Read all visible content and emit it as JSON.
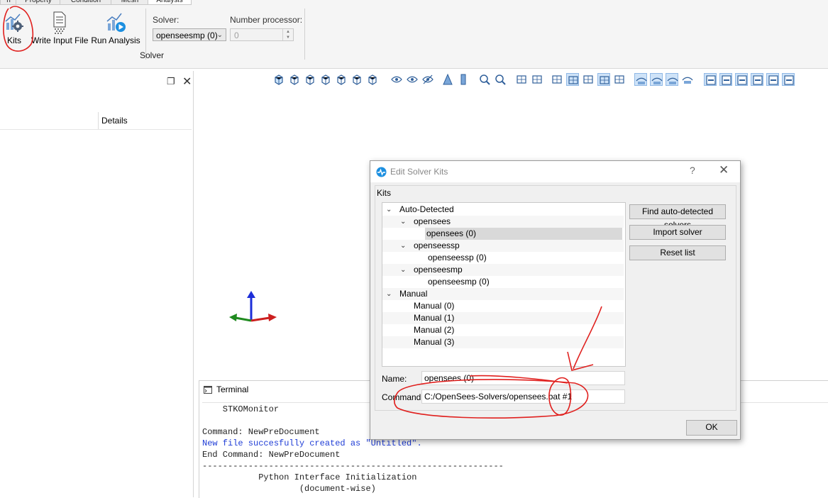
{
  "ribbon": {
    "tabs": [
      "n",
      "Property",
      "Condition",
      "Mesh",
      "Analysis"
    ],
    "buttons": {
      "kits": "Kits",
      "write_input_file": "Write Input File",
      "run_analysis": "Run Analysis"
    },
    "solver_label": "Solver:",
    "solver_value": "openseesmp (0)",
    "nproc_label": "Number processor:",
    "nproc_value": "0",
    "group_label": "Solver"
  },
  "left_panel": {
    "details_header": "Details"
  },
  "view_toolbar": {
    "icons": [
      "iso-view-icon",
      "front-view-icon",
      "back-view-icon",
      "left-view-icon",
      "right-view-icon",
      "top-view-icon",
      "bottom-view-icon",
      "eye-outline-icon",
      "eye-icon",
      "eye-crossed-icon",
      "perspective-icon",
      "orthographic-icon",
      "zoom-fit-icon",
      "zoom-icon",
      "screenshot-icon",
      "pick-icon",
      "grid-icon",
      "grid-selected-icon",
      "angle-icon",
      "select-box-icon",
      "select-tool-icon",
      "show-a-icon",
      "show-b-icon",
      "show-c-icon",
      "hide-icon",
      "layer-1-icon",
      "layer-2-icon",
      "layer-3-icon",
      "layer-4-icon",
      "layer-5-icon",
      "layer-6-icon"
    ]
  },
  "terminal": {
    "title": "Terminal",
    "lines": [
      {
        "text": "    STKOMonitor",
        "color": "normal"
      },
      {
        "text": "",
        "color": "normal"
      },
      {
        "text": "Command: NewPreDocument",
        "color": "normal"
      },
      {
        "text": "New file succesfully created as \"Untitled\".",
        "color": "blue"
      },
      {
        "text": "End Command: NewPreDocument",
        "color": "normal"
      },
      {
        "text": "-----------------------------------------------------------",
        "color": "normal"
      },
      {
        "text": "           Python Interface Initialization",
        "color": "normal"
      },
      {
        "text": "                   (document-wise)",
        "color": "normal"
      }
    ]
  },
  "dialog": {
    "title": "Edit Solver Kits",
    "help": "?",
    "close": "✕",
    "group_label": "Kits",
    "tree": [
      {
        "label": "Auto-Detected",
        "level": 0,
        "expanded": true,
        "selected": false
      },
      {
        "label": "opensees",
        "level": 1,
        "expanded": true,
        "selected": false
      },
      {
        "label": "opensees (0)",
        "level": 2,
        "expanded": false,
        "selected": true
      },
      {
        "label": "openseessp",
        "level": 1,
        "expanded": true,
        "selected": false
      },
      {
        "label": "openseessp (0)",
        "level": 2,
        "expanded": false,
        "selected": false
      },
      {
        "label": "openseesmp",
        "level": 1,
        "expanded": true,
        "selected": false
      },
      {
        "label": "openseesmp (0)",
        "level": 2,
        "expanded": false,
        "selected": false
      },
      {
        "label": "Manual",
        "level": 0,
        "expanded": true,
        "selected": false
      },
      {
        "label": "Manual (0)",
        "level": 1,
        "expanded": false,
        "selected": false
      },
      {
        "label": "Manual (1)",
        "level": 1,
        "expanded": false,
        "selected": false
      },
      {
        "label": "Manual (2)",
        "level": 1,
        "expanded": false,
        "selected": false
      },
      {
        "label": "Manual (3)",
        "level": 1,
        "expanded": false,
        "selected": false
      }
    ],
    "buttons": {
      "find": "Find auto-detected solvers",
      "import": "Import solver",
      "reset": "Reset list",
      "ok": "OK"
    },
    "name_label": "Name:",
    "name_value": "opensees (0)",
    "command_label": "Command:",
    "command_value": "C:/OpenSees-Solvers/opensees.bat #1"
  },
  "colors": {
    "annotation": "#e0201e",
    "axis_x": "#cc1f1f",
    "axis_y": "#1f8a1f",
    "axis_z": "#1c2ed8",
    "terminal_blue": "#1f3dd6"
  }
}
